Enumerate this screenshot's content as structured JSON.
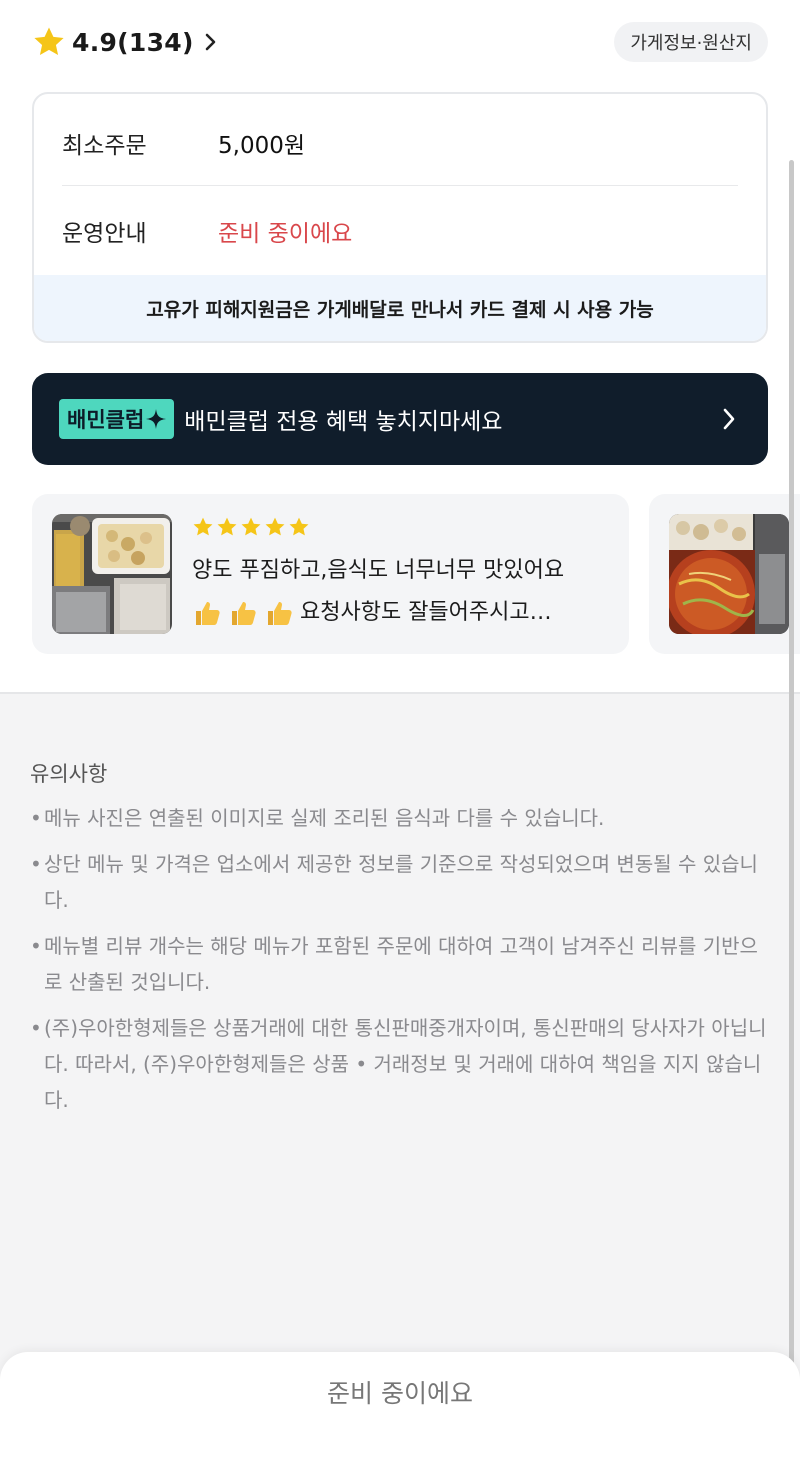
{
  "rating": {
    "value_text": "4.9(134)",
    "icon": "star-icon",
    "star_color": "#f5c518"
  },
  "info_chip": {
    "label": "가게정보·원산지"
  },
  "info_card": {
    "rows": [
      {
        "label": "최소주문",
        "value": "5,000원"
      },
      {
        "label": "운영안내",
        "value": "준비 중이에요",
        "value_color": "#d9474b"
      }
    ],
    "note": "고유가 피해지원금은 가게배달로 만나서 카드 결제 시 사용 가능"
  },
  "club_banner": {
    "badge": "배민클럽",
    "text": "배민클럽 전용 혜택 놓치지마세요",
    "bg_color": "#101d2b",
    "badge_color": "#4ed7be"
  },
  "reviews": [
    {
      "stars": 5,
      "line1": "양도 푸짐하고,음식도 너무너무 맛있어요",
      "emoji_count": 3,
      "emoji_icon": "thumbs-up-icon",
      "line2": "요청사항도 잘들어주시고…"
    }
  ],
  "notice": {
    "title": "유의사항",
    "items": [
      "메뉴 사진은 연출된 이미지로 실제 조리된 음식과 다를 수 있습니다.",
      "상단 메뉴 및 가격은 업소에서 제공한 정보를 기준으로 작성되었으며 변동될 수 있습니다.",
      "메뉴별 리뷰 개수는 해당 메뉴가 포함된 주문에 대하여 고객이 남겨주신 리뷰를 기반으로 산출된 것입니다.",
      "(주)우아한형제들은 상품거래에 대한 통신판매중개자이며, 통신판매의 당사자가 아닙니다. 따라서, (주)우아한형제들은 상품 • 거래정보 및 거래에 대하여 책임을 지지 않습니다."
    ]
  },
  "bottom_bar": {
    "label": "준비 중이에요"
  }
}
